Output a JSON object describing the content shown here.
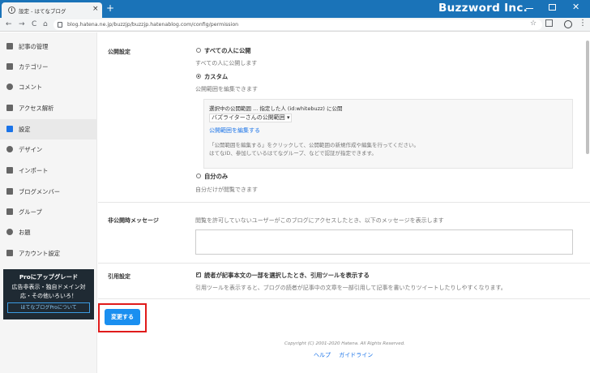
{
  "browser": {
    "tab_title": "設定 - はてなブログ",
    "tab_close": "×",
    "new_tab": "+",
    "url": "blog.hatena.ne.jp/buzzjp/buzzjp.hatenablog.com/config/permission",
    "brand": "Buzzword Inc.",
    "back": "←",
    "forward": "→",
    "reload": "C",
    "home": "⌂",
    "star": "☆",
    "menu": "⋮",
    "close_glyph": "✕"
  },
  "sidebar": {
    "items": [
      {
        "label": "記事の管理",
        "icon": "edit-icon"
      },
      {
        "label": "カテゴリー",
        "icon": "folder-icon"
      },
      {
        "label": "コメント",
        "icon": "comment-icon"
      },
      {
        "label": "アクセス解析",
        "icon": "chart-icon"
      },
      {
        "label": "設定",
        "icon": "wrench-icon"
      },
      {
        "label": "デザイン",
        "icon": "palette-icon"
      },
      {
        "label": "インポート",
        "icon": "import-icon"
      },
      {
        "label": "ブログメンバー",
        "icon": "members-icon"
      },
      {
        "label": "グループ",
        "icon": "group-icon"
      },
      {
        "label": "お題",
        "icon": "topic-icon"
      },
      {
        "label": "アカウント設定",
        "icon": "account-icon"
      }
    ],
    "promo": {
      "title": "Proにアップグレード",
      "line1": "広告非表示・独自ドメイン対",
      "line2": "応・その他いろいろ！",
      "button": "はてなブログProについて"
    }
  },
  "main": {
    "publish": {
      "label": "公開設定",
      "options": [
        {
          "label": "すべての人に公開",
          "desc": "すべての人に公開します",
          "checked": false
        },
        {
          "label": "カスタム",
          "desc": "公開範囲を編集できます",
          "checked": true
        },
        {
          "label": "自分のみ",
          "desc": "自分だけが閲覧できます",
          "checked": false
        }
      ],
      "custom": {
        "selected_line": "選択中の公開範囲 ... 指定した人 (id:whitebuzz) に公開",
        "dropdown": "バズライターさんの公開範囲 ▾",
        "edit_link": "公開範囲を編集する",
        "note1": "「公開範囲を編集する」をクリックして、公開範囲の新規作成や編集を行ってください。",
        "note2": "はてなID、参加しているはてなグループ、などで認証が指定できます。"
      }
    },
    "private_message": {
      "label": "非公開時メッセージ",
      "desc": "閲覧を許可していないユーザーがこのブログにアクセスしたとき、以下のメッセージを表示します",
      "value": ""
    },
    "quote": {
      "label": "引用設定",
      "checkbox_label": "読者が記事本文の一部を選択したとき、引用ツールを表示する",
      "checked": true,
      "desc": "引用ツールを表示すると、ブログの読者が記事中の文章を一部引用して記事を書いたりツイートしたりしやすくなります。"
    },
    "save_button": "変更する",
    "copyright": "Copyright (C) 2001-2020 Hatena. All Rights Reserved.",
    "footer_links": [
      "ヘルプ",
      "ガイドライン"
    ]
  },
  "colors": {
    "browser_chrome": "#1a73b8",
    "primary_button": "#1a8ff0",
    "highlight_border": "#e01b1b",
    "link": "#1a73e8"
  }
}
